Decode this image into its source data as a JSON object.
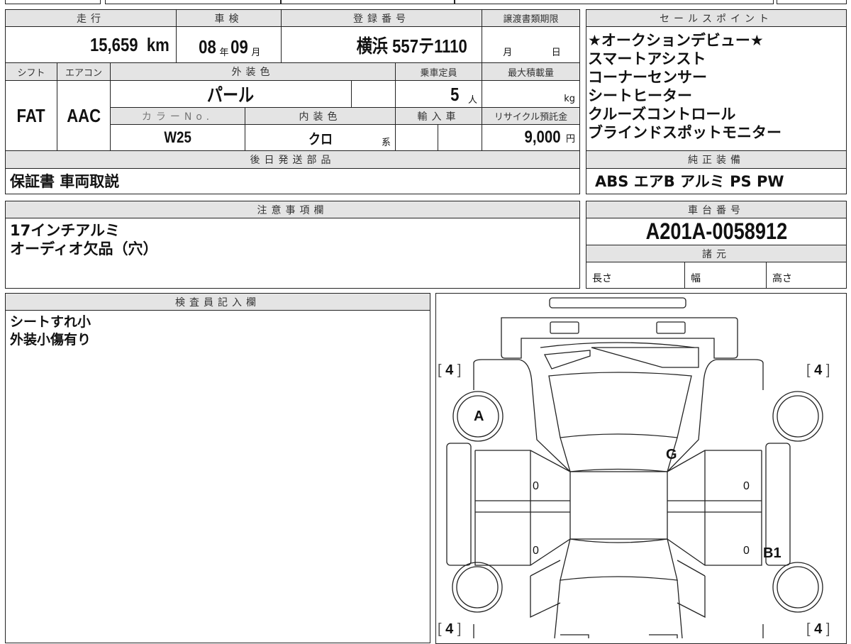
{
  "vehicle": {
    "mileage_label": "走行",
    "mileage": "15,659",
    "mileage_unit": "km",
    "inspection_label": "車検",
    "inspection_year": "08",
    "year_unit": "年",
    "inspection_month": "09",
    "month_unit": "月",
    "registration_label": "登録番号",
    "registration_number": "横浜 557テ1110",
    "transfer_deadline_label": "譲渡書類期限",
    "transfer_month_unit": "月",
    "transfer_day_unit": "日",
    "shift_label": "シフト",
    "shift": "FAT",
    "ac_label": "エアコン",
    "ac": "AAC",
    "exterior_color_label": "外装色",
    "exterior_color": "パール",
    "capacity_label": "乗車定員",
    "capacity": "5",
    "capacity_unit": "人",
    "max_load_label": "最大積載量",
    "max_load_unit": "kg",
    "color_no_label": "カラーNo.",
    "color_no": "W25",
    "interior_color_label": "内装色",
    "interior_color": "クロ",
    "interior_suffix": "系",
    "import_label": "輸入車",
    "recycle_label": "リサイクル預託金",
    "recycle_fee": "9,000",
    "recycle_unit": "円",
    "later_parts_label": "後日発送部品",
    "later_parts": "保証書 車両取説"
  },
  "sales_points": {
    "label": "セールスポイント",
    "items": [
      "★オークションデビュー★",
      "スマートアシスト",
      "コーナーセンサー",
      "シートヒーター",
      "クルーズコントロール",
      "ブラインドスポットモニター"
    ]
  },
  "equipment": {
    "label": "純正装備",
    "value": "ABS エアB アルミ PS PW"
  },
  "notes": {
    "label": "注意事項欄",
    "lines": [
      "17インチアルミ",
      "オーディオ欠品（穴）"
    ]
  },
  "chassis": {
    "label": "車台番号",
    "value": "A201A-0058912",
    "spec_label": "諸元",
    "length": "長さ",
    "width": "幅",
    "height": "高さ"
  },
  "inspector": {
    "label": "検査員記入欄",
    "lines": [
      "シートすれ小",
      "外装小傷有り"
    ]
  },
  "diagram": {
    "tire_fl": "4",
    "tire_fr": "4",
    "tire_rl": "4",
    "tire_rr": "4",
    "mark_a": "A",
    "mark_g": "G",
    "mark_b1": "B1",
    "zero1": "0",
    "zero2": "0",
    "zero3": "0",
    "zero4": "0",
    "bl": "[",
    "br": "]"
  }
}
